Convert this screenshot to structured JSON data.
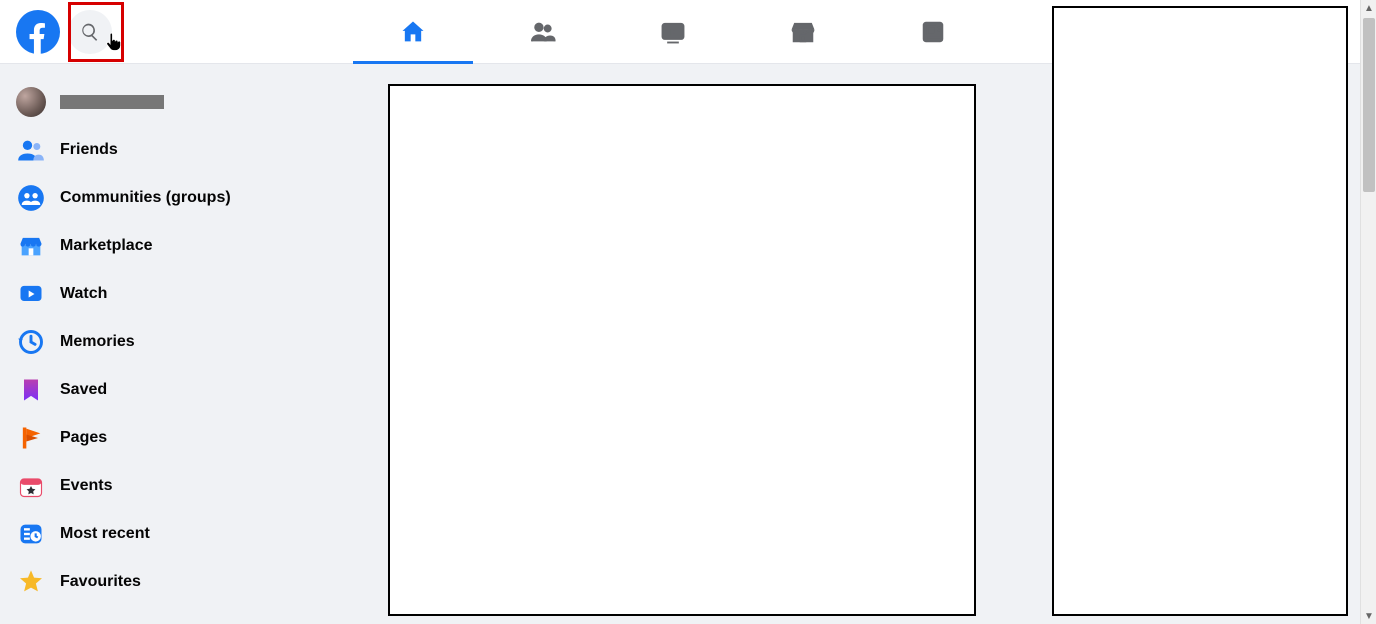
{
  "sidebar": {
    "profile_name": "",
    "items": [
      {
        "label": "Friends"
      },
      {
        "label": "Communities (groups)"
      },
      {
        "label": "Marketplace"
      },
      {
        "label": "Watch"
      },
      {
        "label": "Memories"
      },
      {
        "label": "Saved"
      },
      {
        "label": "Pages"
      },
      {
        "label": "Events"
      },
      {
        "label": "Most recent"
      },
      {
        "label": "Favourites"
      }
    ]
  },
  "nav": {
    "tabs": [
      "home",
      "friends",
      "watch",
      "marketplace",
      "feeds"
    ]
  }
}
